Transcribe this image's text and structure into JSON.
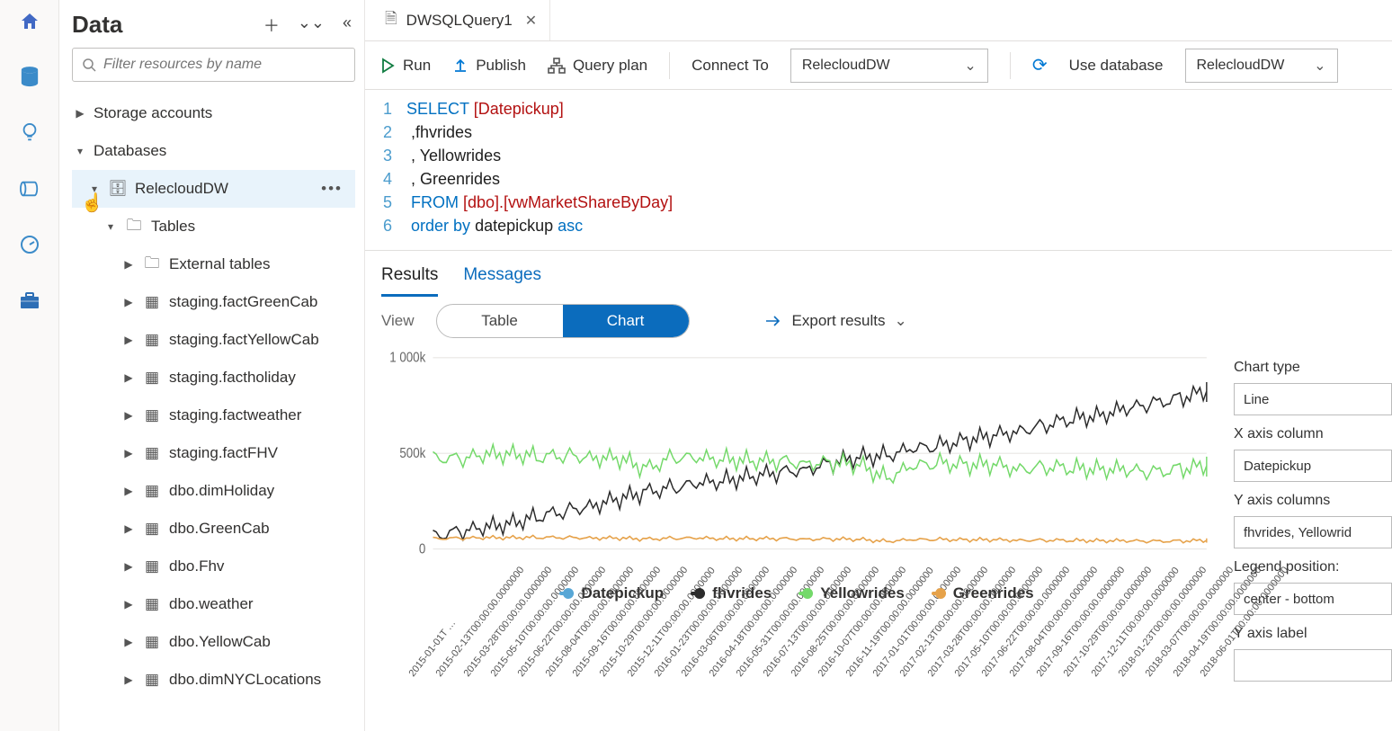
{
  "panel": {
    "title": "Data",
    "filter_placeholder": "Filter resources by name"
  },
  "tree": {
    "storage": "Storage accounts",
    "databases": "Databases",
    "dw": "RelecloudDW",
    "tables": "Tables",
    "ext": "External tables",
    "items": [
      "staging.factGreenCab",
      "staging.factYellowCab",
      "staging.factholiday",
      "staging.factweather",
      "staging.factFHV",
      "dbo.dimHoliday",
      "dbo.GreenCab",
      "dbo.Fhv",
      "dbo.weather",
      "dbo.YellowCab",
      "dbo.dimNYCLocations"
    ]
  },
  "tab": {
    "name": "DWSQLQuery1"
  },
  "toolbar": {
    "run": "Run",
    "publish": "Publish",
    "queryplan": "Query plan",
    "connect_to": "Connect To",
    "connect_val": "RelecloudDW",
    "use_db": "Use database",
    "use_db_val": "RelecloudDW"
  },
  "editor": {
    "lines": [
      "1",
      "2",
      "3",
      "4",
      "5",
      "6"
    ],
    "l1a": "SELECT ",
    "l1b": "[Datepickup]",
    "l2": " ,fhvrides",
    "l3": " , Yellowrides",
    "l4": " , Greenrides",
    "l5a": " FROM ",
    "l5b": "[dbo].[vwMarketShareByDay]",
    "l6a": " order ",
    "l6b": "by ",
    "l6c": "datepickup ",
    "l6d": "asc"
  },
  "results": {
    "tab_results": "Results",
    "tab_messages": "Messages",
    "view": "View",
    "seg_table": "Table",
    "seg_chart": "Chart",
    "export": "Export results"
  },
  "chart_opts": {
    "type_lbl": "Chart type",
    "type_val": "Line",
    "x_lbl": "X axis column",
    "x_val": "Datepickup",
    "y_lbl": "Y axis columns",
    "y_val": "fhvrides, Yellowrid",
    "leg_lbl": "Legend position:",
    "leg_val": "center - bottom",
    "ylab_lbl": "Y axis label",
    "ylab_val": ""
  },
  "legend": {
    "a": "Datepickup",
    "b": "fhvrides",
    "c": "Yellowrides",
    "d": "Greenrides"
  },
  "chart_data": {
    "type": "line",
    "title": "",
    "xlabel": "",
    "ylabel": "",
    "ylim": [
      0,
      1000000
    ],
    "y_ticks": [
      "0",
      "500k",
      "1 000k"
    ],
    "x_ticks": [
      "2015-01-01T …",
      "2015-02-13T00:00:00.0000000",
      "2015-03-28T00:00:00.0000000",
      "2015-05-10T00:00:00.0000000",
      "2015-06-22T00:00:00.0000000",
      "2015-08-04T00:00:00.0000000",
      "2015-09-16T00:00:00.0000000",
      "2015-10-29T00:00:00.0000000",
      "2015-12-11T00:00:00.0000000",
      "2016-01-23T00:00:00.0000000",
      "2016-03-06T00:00:00.0000000",
      "2016-04-18T00:00:00.0000000",
      "2016-05-31T00:00:00.0000000",
      "2016-07-13T00:00:00.0000000",
      "2016-08-25T00:00:00.0000000",
      "2016-10-07T00:00:00.0000000",
      "2016-11-19T00:00:00.0000000",
      "2017-01-01T00:00:00.0000000",
      "2017-02-13T00:00:00.0000000",
      "2017-03-28T00:00:00.0000000",
      "2017-05-10T00:00:00.0000000",
      "2017-06-22T00:00:00.0000000",
      "2017-08-04T00:00:00.0000000",
      "2017-09-16T00:00:00.0000000",
      "2017-10-29T00:00:00.0000000",
      "2017-12-11T00:00:00.0000000",
      "2018-01-23T00:00:00.0000000",
      "2018-03-07T00:00:00.0000000",
      "2018-04-19T00:00:00.0000000",
      "2018-06-01T00:00:00.0000000"
    ],
    "series": [
      {
        "name": "fhvrides",
        "color": "#2b2b2b",
        "values": [
          70000,
          90000,
          110000,
          140000,
          170000,
          200000,
          230000,
          260000,
          300000,
          320000,
          340000,
          360000,
          380000,
          400000,
          420000,
          450000,
          480000,
          490000,
          520000,
          540000,
          570000,
          590000,
          620000,
          650000,
          680000,
          700000,
          730000,
          760000,
          790000,
          820000
        ]
      },
      {
        "name": "Yellowrides",
        "color": "#74d96a",
        "values": [
          480000,
          470000,
          490000,
          500000,
          480000,
          490000,
          480000,
          470000,
          420000,
          480000,
          470000,
          470000,
          460000,
          460000,
          450000,
          450000,
          440000,
          370000,
          430000,
          450000,
          440000,
          440000,
          420000,
          430000,
          420000,
          420000,
          410000,
          400000,
          420000,
          430000
        ]
      },
      {
        "name": "Greenrides",
        "color": "#e6a24a",
        "values": [
          55000,
          56000,
          58000,
          60000,
          60000,
          60000,
          58000,
          56000,
          52000,
          56000,
          56000,
          54000,
          54000,
          54000,
          52000,
          52000,
          50000,
          40000,
          48000,
          50000,
          48000,
          48000,
          46000,
          46000,
          44000,
          44000,
          42000,
          40000,
          42000,
          44000
        ]
      }
    ]
  }
}
